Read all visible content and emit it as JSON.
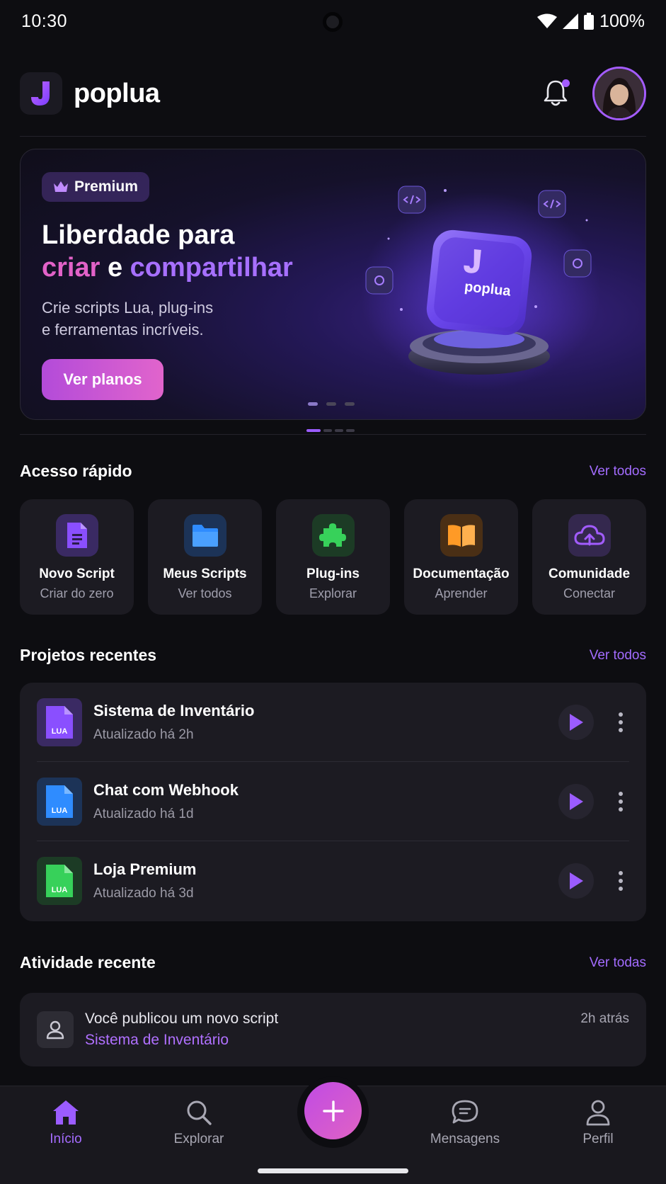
{
  "status_bar": {
    "time": "10:30",
    "battery": "100%"
  },
  "header": {
    "app_name": "poplua",
    "notification_dot": true
  },
  "hero": {
    "badge": "Premium",
    "title_line1": "Liberdade para",
    "title_word1": "criar",
    "title_joiner": "e",
    "title_word2": "compartilhar",
    "desc_line1": "Crie scripts Lua, plug-ins",
    "desc_line2": "e ferramentas incríveis.",
    "cta": "Ver planos",
    "art_label": "poplua",
    "slide_count": 3,
    "active_slide": 1
  },
  "quick_access": {
    "title": "Acesso rápido",
    "see_all": "Ver todos",
    "items": [
      {
        "title": "Novo Script",
        "subtitle": "Criar do zero",
        "icon": "document-icon",
        "color": "#8a4fff",
        "bg": "#3a2a63"
      },
      {
        "title": "Meus Scripts",
        "subtitle": "Ver todos",
        "icon": "folder-icon",
        "color": "#2f8cff",
        "bg": "#1c3357"
      },
      {
        "title": "Plug-ins",
        "subtitle": "Explorar",
        "icon": "puzzle-icon",
        "color": "#37d15a",
        "bg": "#1c3b25"
      },
      {
        "title": "Documentação",
        "subtitle": "Aprender",
        "icon": "book-icon",
        "color": "#ff9a26",
        "bg": "#4a2f15"
      },
      {
        "title": "Comunidade",
        "subtitle": "Conectar",
        "icon": "cloud-icon",
        "color": "#a25cff",
        "bg": "#34284e"
      }
    ]
  },
  "recent_projects": {
    "title": "Projetos recentes",
    "see_all": "Ver todos",
    "items": [
      {
        "name": "Sistema de Inventário",
        "updated": "Atualizado há 2h",
        "file_label": "LUA",
        "color": "#8a4fff",
        "bg": "#3a2a63"
      },
      {
        "name": "Chat com Webhook",
        "updated": "Atualizado há 1d",
        "file_label": "LUA",
        "color": "#2f8cff",
        "bg": "#1c3357"
      },
      {
        "name": "Loja Premium",
        "updated": "Atualizado há 3d",
        "file_label": "LUA",
        "color": "#37d15a",
        "bg": "#1c3b25"
      }
    ]
  },
  "recent_activity": {
    "title": "Atividade recente",
    "see_all": "Ver todas",
    "items": [
      {
        "text": "Você publicou um novo script",
        "link": "Sistema de Inventário",
        "time": "2h atrás"
      }
    ]
  },
  "bottom_nav": {
    "items": [
      {
        "label": "Início",
        "icon": "home-icon",
        "active": true
      },
      {
        "label": "Explorar",
        "icon": "search-icon",
        "active": false
      },
      {
        "label": "Mensagens",
        "icon": "message-icon",
        "active": false
      },
      {
        "label": "Perfil",
        "icon": "profile-icon",
        "active": false
      }
    ],
    "fab_icon": "plus-icon"
  },
  "colors": {
    "accent": "#a56cff",
    "background": "#0d0d11",
    "card": "#1c1b22"
  }
}
